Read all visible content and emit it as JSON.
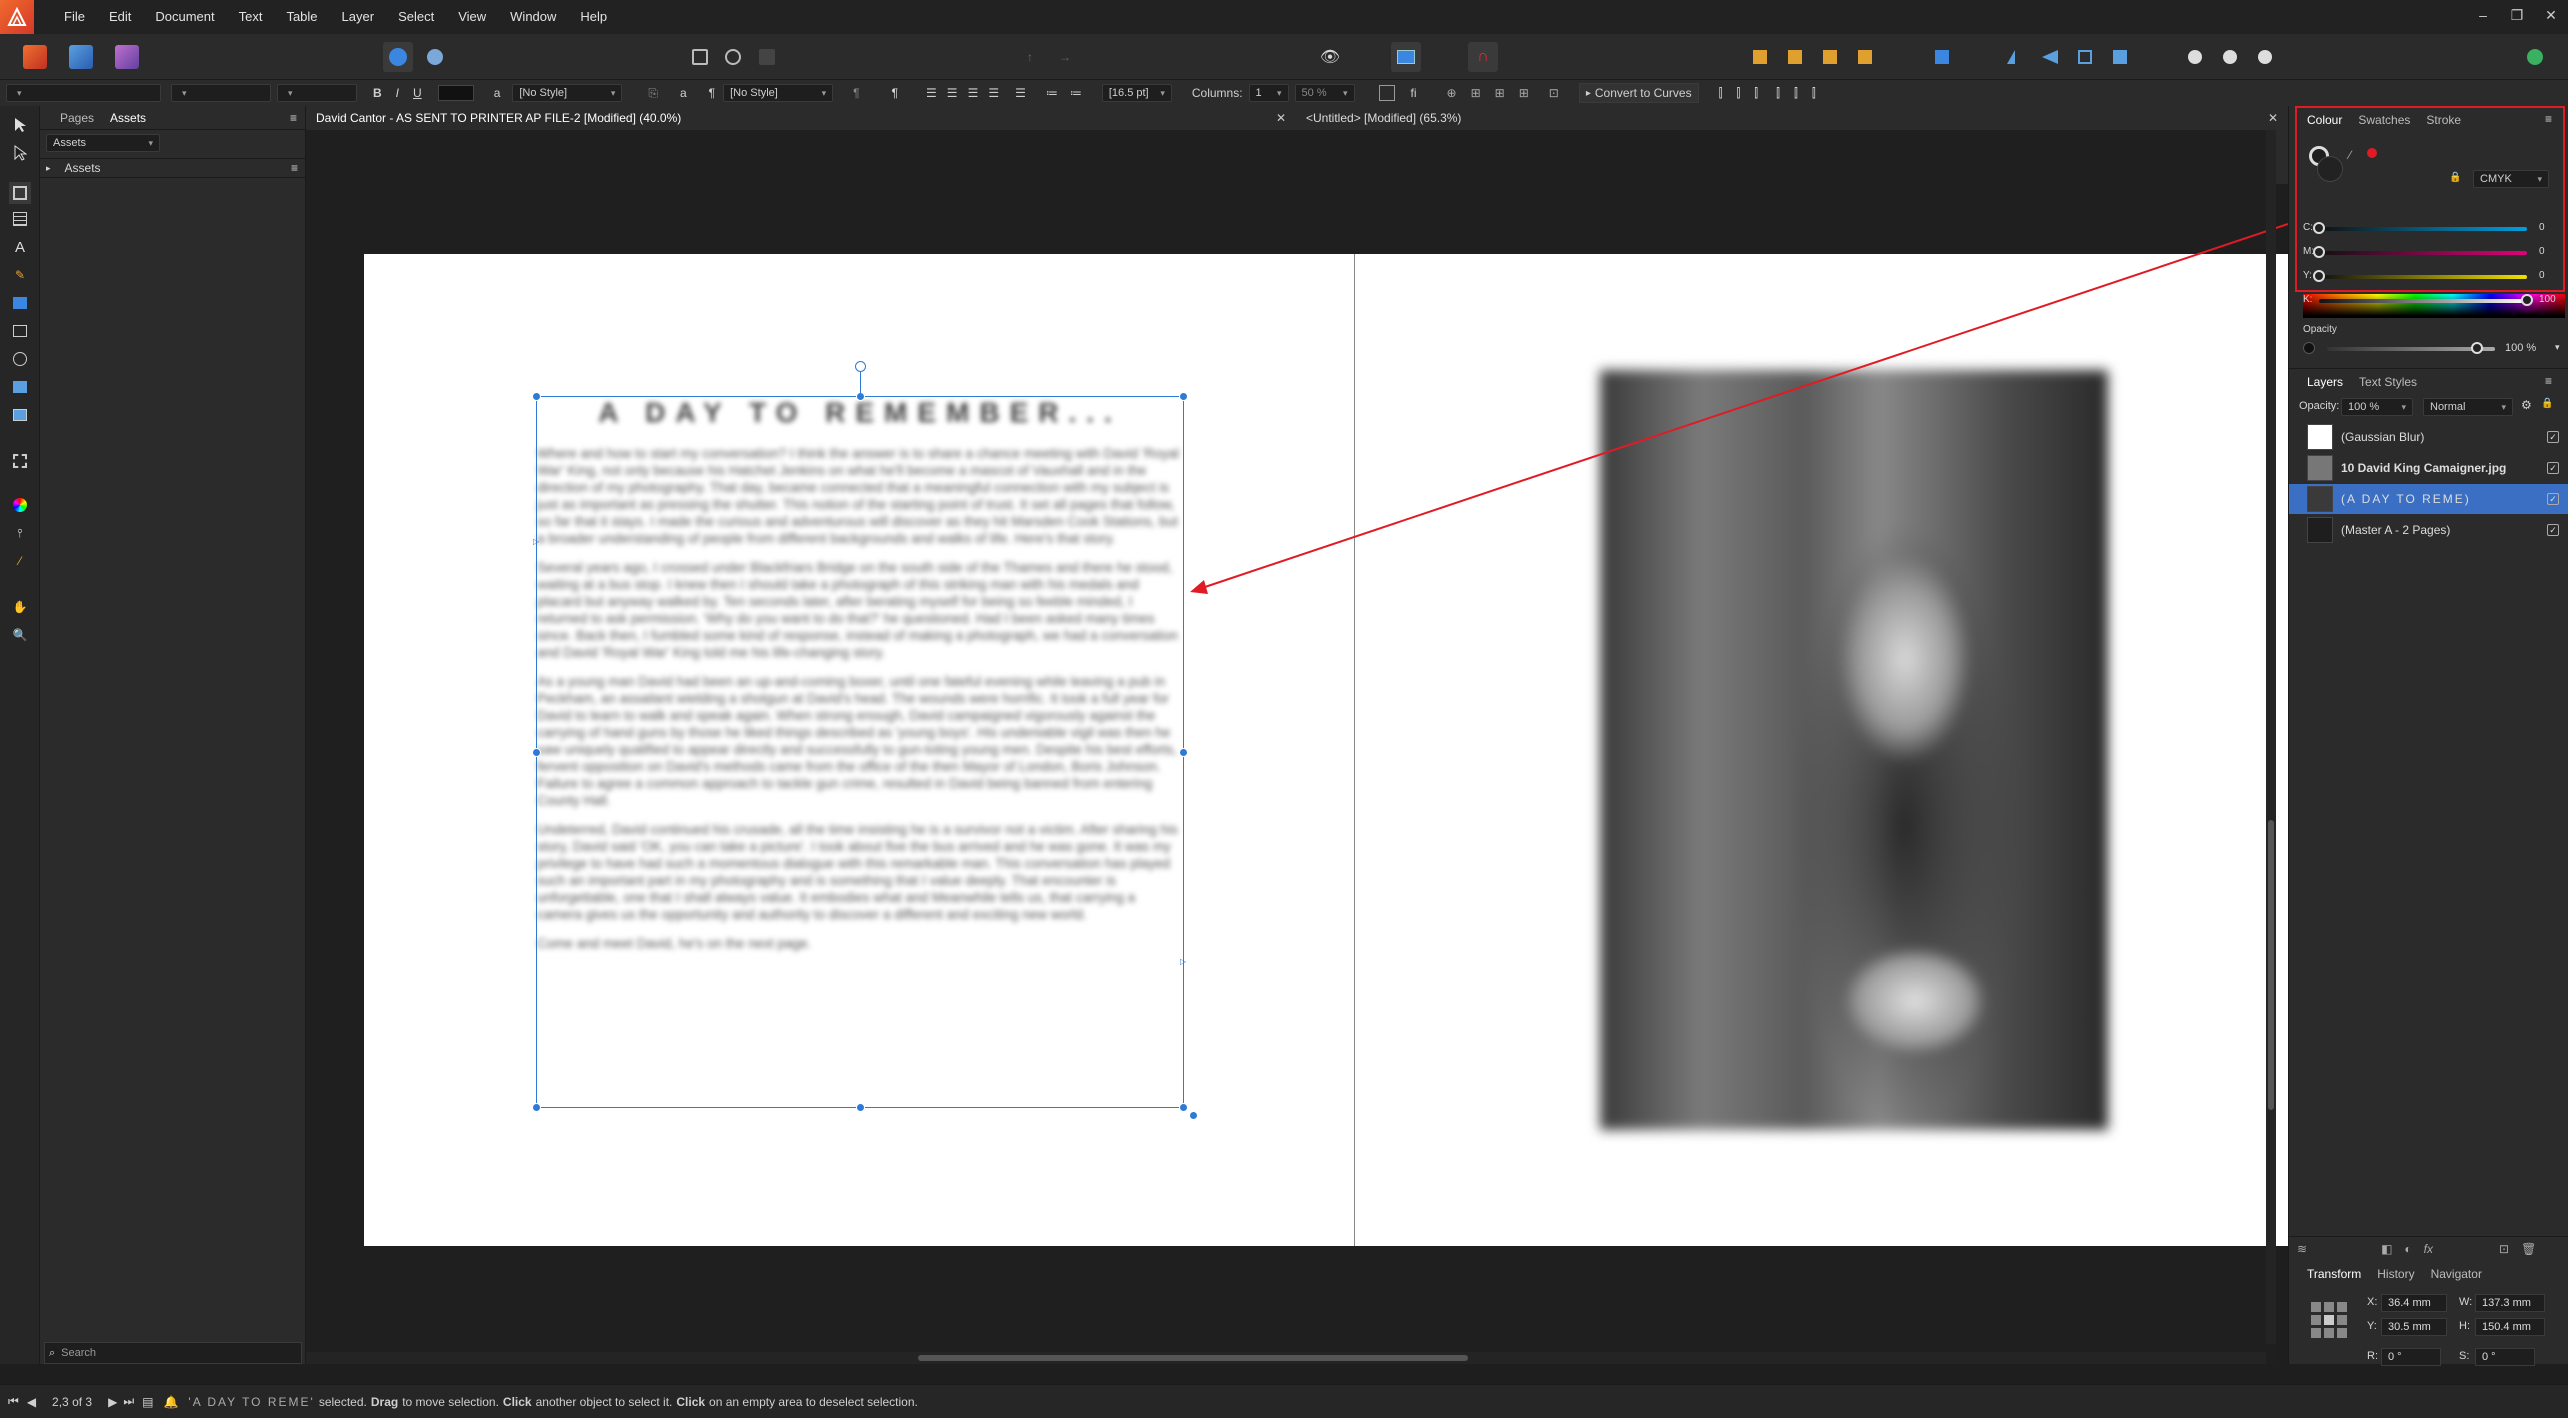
{
  "app": {
    "name": "Affinity Publisher",
    "accent": "#2e7ad6"
  },
  "menu": [
    "File",
    "Edit",
    "Document",
    "Text",
    "Table",
    "Layer",
    "Select",
    "View",
    "Window",
    "Help"
  ],
  "context_toolbar": {
    "paragraph_style": "[No Style]",
    "character_style": "[No Style]",
    "font_size": "[16.5 pt]",
    "columns_label": "Columns:",
    "columns_value": "1",
    "gutter": "50 %",
    "convert_label": "Convert to Curves",
    "bold": "B",
    "italic": "I",
    "underline": "U",
    "char_a": "a",
    "pilcrow": "¶"
  },
  "left_panel": {
    "tabs": [
      "Pages",
      "Assets"
    ],
    "active_tab": "Assets",
    "dropdown": "Assets",
    "section": "Assets",
    "search_placeholder": "Search"
  },
  "documents": [
    {
      "title": "David Cantor - AS SENT TO PRINTER AP FILE-2 [Modified] (40.0%)"
    },
    {
      "title": "<Untitled> [Modified] (65.3%)"
    }
  ],
  "page_content": {
    "heading": "A DAY TO REMEMBER...",
    "paragraphs": [
      "Where and how to start my conversation? I think the answer is to share a chance meeting with David 'Royal War' King, not only because his Hatchet Jenkins on what he'll become a mascot of Vauxhall and in the direction of my photography. That day, became connected that a meaningful connection with my subject is just as important as pressing the shutter. This notion of the starting point of trust. It set all pages that follow, so far that it stays. I made the curious and adventurous will discover as they hit Marsden Cook Stations, but a broader understanding of people from different backgrounds and walks of life. Here's that story.",
      "Several years ago, I crossed under Blackfriars Bridge on the south side of the Thames and there he stood, waiting at a bus stop. I knew then I should take a photograph of this striking man with his medals and placard but anyway walked by. Ten seconds later, after berating myself for being so feeble minded, I returned to ask permission. 'Why do you want to do that?' he questioned. Had I been asked many times since. Back then, I fumbled some kind of response, instead of making a photograph, we had a conversation and David 'Royal War' King told me his life-changing story.",
      "As a young man David had been an up-and-coming boxer, until one fateful evening while leaving a pub in Peckham, an assailant wielding a shotgun at David's head. The wounds were horrific. It took a full year for David to learn to walk and speak again. When strong enough, David campaigned vigorously against the carrying of hand guns by those he liked things described as 'young boys'. His undeniable vigil was then he saw uniquely qualified to appear directly and successfully to gun-toting young men. Despite his best efforts, fervent opposition on David's methods came from the office of the then Mayor of London, Boris Johnson. Failure to agree a common approach to tackle gun crime, resulted in David being banned from entering County Hall.",
      "Undeterred, David continued his crusade, all the time insisting he is a survivor not a victim. After sharing his story, David said 'OK, you can take a picture'. I took about five the bus arrived and he was gone. It was my privilege to have had such a momentous dialogue with this remarkable man. This conversation has played such an important part in my photography and is something that I value deeply. That encounter is unforgettable, one that I shall always value. It embodies what and Meanwhile tells us, that carrying a camera gives us the opportunity and authority to discover a different and exciting new world.",
      "Come and meet David, he's on the next page."
    ]
  },
  "right_panel": {
    "color_tabs": [
      "Colour",
      "Swatches",
      "Stroke"
    ],
    "color_mode": "CMYK",
    "cmyk": [
      {
        "label": "C:",
        "value": "0",
        "color": "#00a0e0"
      },
      {
        "label": "M:",
        "value": "0",
        "color": "#e0007a"
      },
      {
        "label": "Y:",
        "value": "0",
        "color": "#f0e000"
      },
      {
        "label": "K:",
        "value": "100",
        "color": "#ffffff"
      }
    ],
    "opacity_label": "Opacity",
    "opacity_value": "100 %",
    "layer_tabs": [
      "Layers",
      "Text Styles"
    ],
    "layer_opacity_label": "Opacity:",
    "layer_opacity": "100 %",
    "blend_mode": "Normal",
    "layers": [
      {
        "name": "(Gaussian Blur)",
        "selected": false,
        "bold": false
      },
      {
        "name": "10 David King Camaigner.jpg",
        "selected": false,
        "bold": true
      },
      {
        "name": "(A DAY TO REME)",
        "selected": true,
        "bold": false
      },
      {
        "name": "(Master A - 2 Pages)",
        "selected": false,
        "bold": false
      }
    ],
    "transform_tabs": [
      "Transform",
      "History",
      "Navigator"
    ],
    "transform": {
      "x_label": "X:",
      "x": "36.4 mm",
      "y_label": "Y:",
      "y": "30.5 mm",
      "w_label": "W:",
      "w": "137.3 mm",
      "h_label": "H:",
      "h": "150.4 mm",
      "r_label": "R:",
      "r": "0 °",
      "s_label": "S:",
      "s": "0 °"
    }
  },
  "status": {
    "page": "2,3 of 3",
    "selected_name": "'A DAY TO REME'",
    "message_1": "selected.",
    "drag": "Drag",
    "message_2": "to move selection.",
    "click1": "Click",
    "message_3": "another object to select it.",
    "click2": "Click",
    "message_4": "on an empty area to deselect selection."
  }
}
